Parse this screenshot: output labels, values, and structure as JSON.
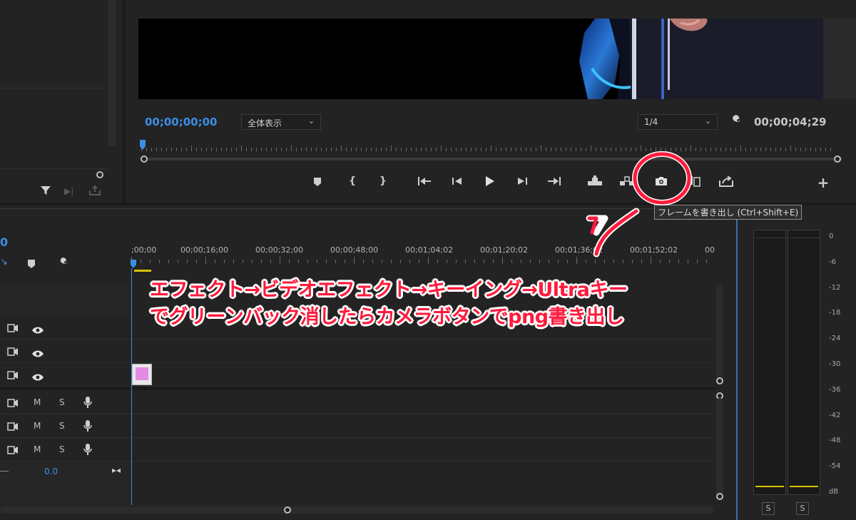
{
  "program_monitor": {
    "timecode_current": "00;00;00;00",
    "zoom_label": "全体表示",
    "resolution_label": "1/4",
    "timecode_duration": "00;00;04;29"
  },
  "tooltip": {
    "text": "フレームを書き出し (Ctrl+Shift+E)"
  },
  "timeline": {
    "timecode_partial": "0",
    "ruler_labels": [
      ";00;00",
      "00;00;16;00",
      "00;00;32;00",
      "00;00;48;00",
      "00;01;04;02",
      "00;01;20;02",
      "00;01;36;02",
      "00;01;52;02",
      "00"
    ],
    "audio_tracks": [
      {
        "mute": "M",
        "solo": "S"
      },
      {
        "mute": "M",
        "solo": "S"
      },
      {
        "mute": "M",
        "solo": "S"
      }
    ],
    "master_value": "0.0"
  },
  "audio_meter": {
    "db_labels": [
      "0",
      "-6",
      "-12",
      "-18",
      "-24",
      "-30",
      "-36",
      "-42",
      "-48",
      "-54",
      "dB"
    ],
    "solo_left": "S",
    "solo_right": "S"
  },
  "annotation": {
    "line1": "エフェクト→ビデオエフェクト→キーイング→Ultraキー",
    "line2": "でグリーンバック消したらカメラボタンでpng書き出し"
  },
  "colors": {
    "accent_blue": "#3b8ee5",
    "annotation_red": "#ff1a3c",
    "clip_pink": "#e48be6",
    "meter_yellow": "#d8c400"
  }
}
